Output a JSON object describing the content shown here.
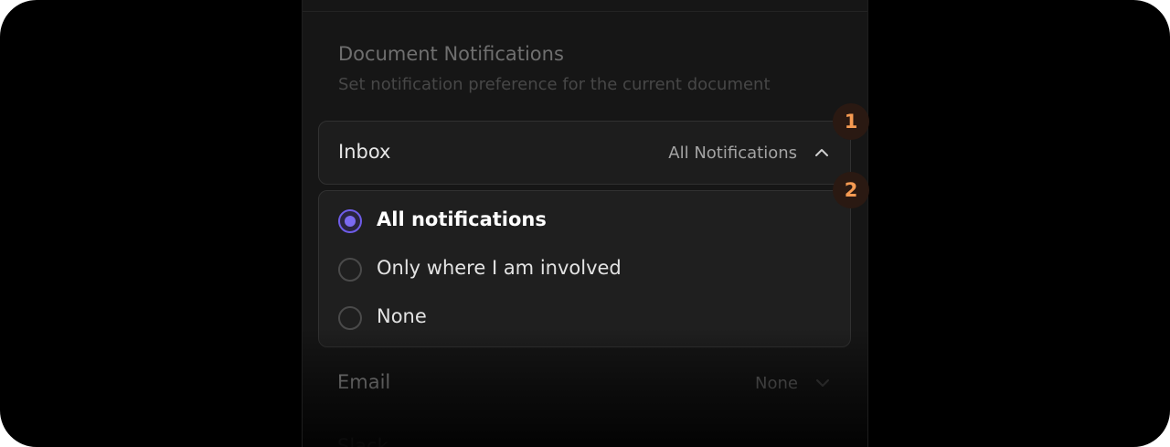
{
  "section": {
    "title": "Document Notifications",
    "subtitle": "Set notification preference for the current document"
  },
  "inbox": {
    "label": "Inbox",
    "value": "All Notifications",
    "expanded": true,
    "chevron_icon": "chevron-up-icon"
  },
  "dropdown": {
    "options": [
      {
        "label": "All notifications",
        "selected": true
      },
      {
        "label": "Only where I am involved",
        "selected": false
      },
      {
        "label": "None",
        "selected": false
      }
    ]
  },
  "email": {
    "label": "Email",
    "value": "None",
    "chevron_icon": "chevron-down-icon"
  },
  "slack": {
    "label": "Slack"
  },
  "markers": [
    "1",
    "2"
  ],
  "colors": {
    "accent": "#6e5ce8",
    "marker_text": "#f59a52",
    "marker_bg": "#2a1912",
    "panel_bg": "#161616"
  }
}
